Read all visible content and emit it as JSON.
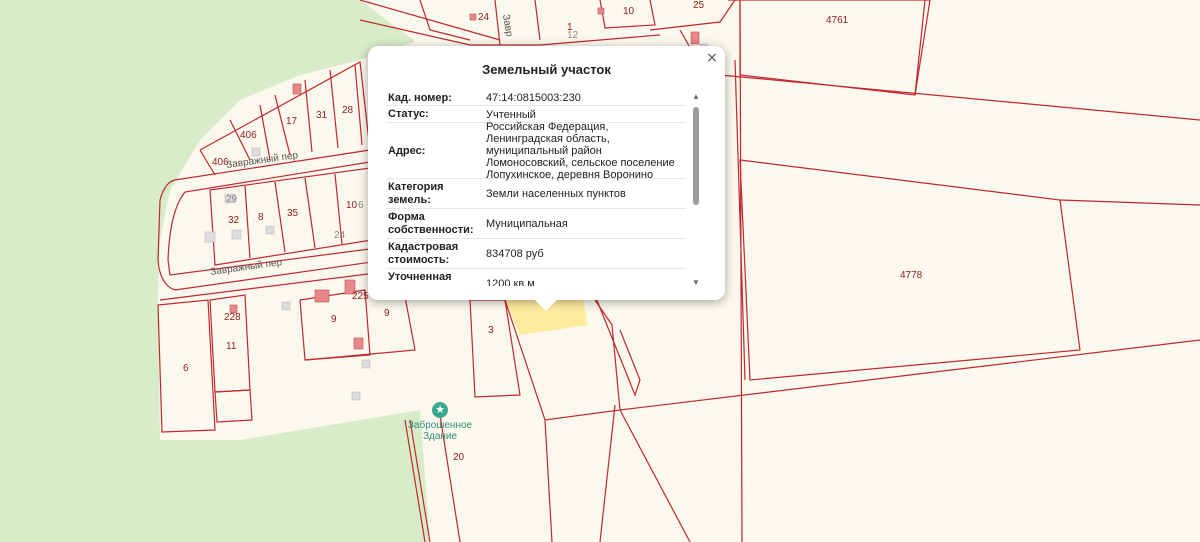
{
  "map": {
    "parcel_numbers": [
      "24",
      "1",
      "12",
      "10",
      "25",
      "4761",
      "406",
      "17",
      "31",
      "28",
      "406",
      "29",
      "32",
      "8",
      "35",
      "10",
      "6",
      "24",
      "4778",
      "225",
      "9",
      "9",
      "228",
      "11",
      "6",
      "3",
      "20"
    ],
    "streets": [
      "Завражный пер",
      "Завражный пер",
      "Завр"
    ],
    "poi": {
      "label_line1": "Заброшенное",
      "label_line2": "Здание",
      "icon": "star-icon"
    },
    "colors": {
      "parcel_border": "#c0282d",
      "green_area": "#d8ecc9",
      "background": "#fbf8ee",
      "selected_parcel": "#ffe98f",
      "building": "#e8868a"
    }
  },
  "popup": {
    "title": "Земельный участок",
    "close_label": "×",
    "rows": [
      {
        "label": "Кад. номер:",
        "value": "47:14:0815003:230"
      },
      {
        "label": "Статус:",
        "value": "Учтенный"
      },
      {
        "label": "Адрес:",
        "value": "Российская Федерация, Ленинградская область, муниципальный район Ломоносовский, сельское поселение Лопухинское, деревня Воронино"
      },
      {
        "label": "Категория земель:",
        "value": "Земли населенных пунктов"
      },
      {
        "label": "Форма собственности:",
        "value": "Муниципальная"
      },
      {
        "label": "Кадастровая стоимость:",
        "value": "834708 руб"
      },
      {
        "label": "Уточненная площадь:",
        "value": "1200 кв.м"
      }
    ],
    "scroll_up": "▲",
    "scroll_down": "▼"
  }
}
